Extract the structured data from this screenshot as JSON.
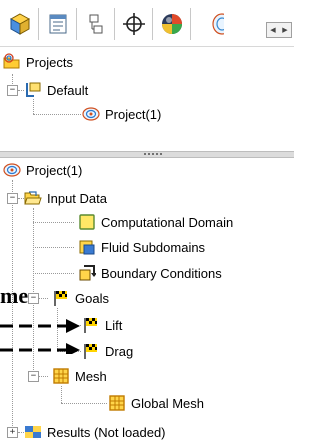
{
  "toolbar": {
    "buttons": [
      {
        "name": "feature-manager-tab",
        "icon": "cube-icon"
      },
      {
        "name": "property-manager-tab",
        "icon": "list-icon"
      },
      {
        "name": "configuration-manager-tab",
        "icon": "tree-icon"
      },
      {
        "name": "dimxpert-tab",
        "icon": "crosshair-icon"
      },
      {
        "name": "display-manager-tab",
        "icon": "color-ball-icon"
      },
      {
        "name": "flow-simulation-tab",
        "icon": "project-icon"
      }
    ]
  },
  "top_tree": {
    "projects": "Projects",
    "default": "Default",
    "project": "Project(1)"
  },
  "bottom_tree": {
    "project": "Project(1)",
    "input_data": "Input Data",
    "computational_domain": "Computational Domain",
    "fluid_subdomains": "Fluid Subdomains",
    "boundary_conditions": "Boundary Conditions",
    "goals": "Goals",
    "lift": "Lift",
    "drag": "Drag",
    "mesh": "Mesh",
    "global_mesh": "Global Mesh",
    "results": "Results (Not loaded)"
  },
  "annotation": {
    "text": "me"
  }
}
